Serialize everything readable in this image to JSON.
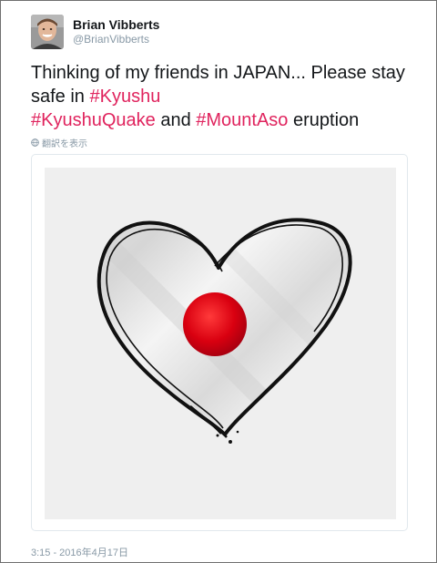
{
  "author": {
    "display_name": "Brian Vibberts",
    "handle": "@BrianVibberts"
  },
  "tweet": {
    "line1": "Thinking of my friends in JAPAN... Please stay",
    "line2_text": "safe in ",
    "hashtag_kyushu": "#Kyushu",
    "hashtag_kyushuquake": "#KyushuQuake",
    "and_text": " and ",
    "hashtag_mountaso": "#MountAso",
    "eruption_text": " eruption"
  },
  "translate_label": "翻訳を表示",
  "timestamp": "3:15 - 2016年4月17日",
  "colors": {
    "hashtag": "#e0245e",
    "meta": "#8899a6",
    "flag_red": "#d10014"
  },
  "icons": {
    "translate": "globe-icon",
    "media": "heart-japan-flag-image"
  }
}
